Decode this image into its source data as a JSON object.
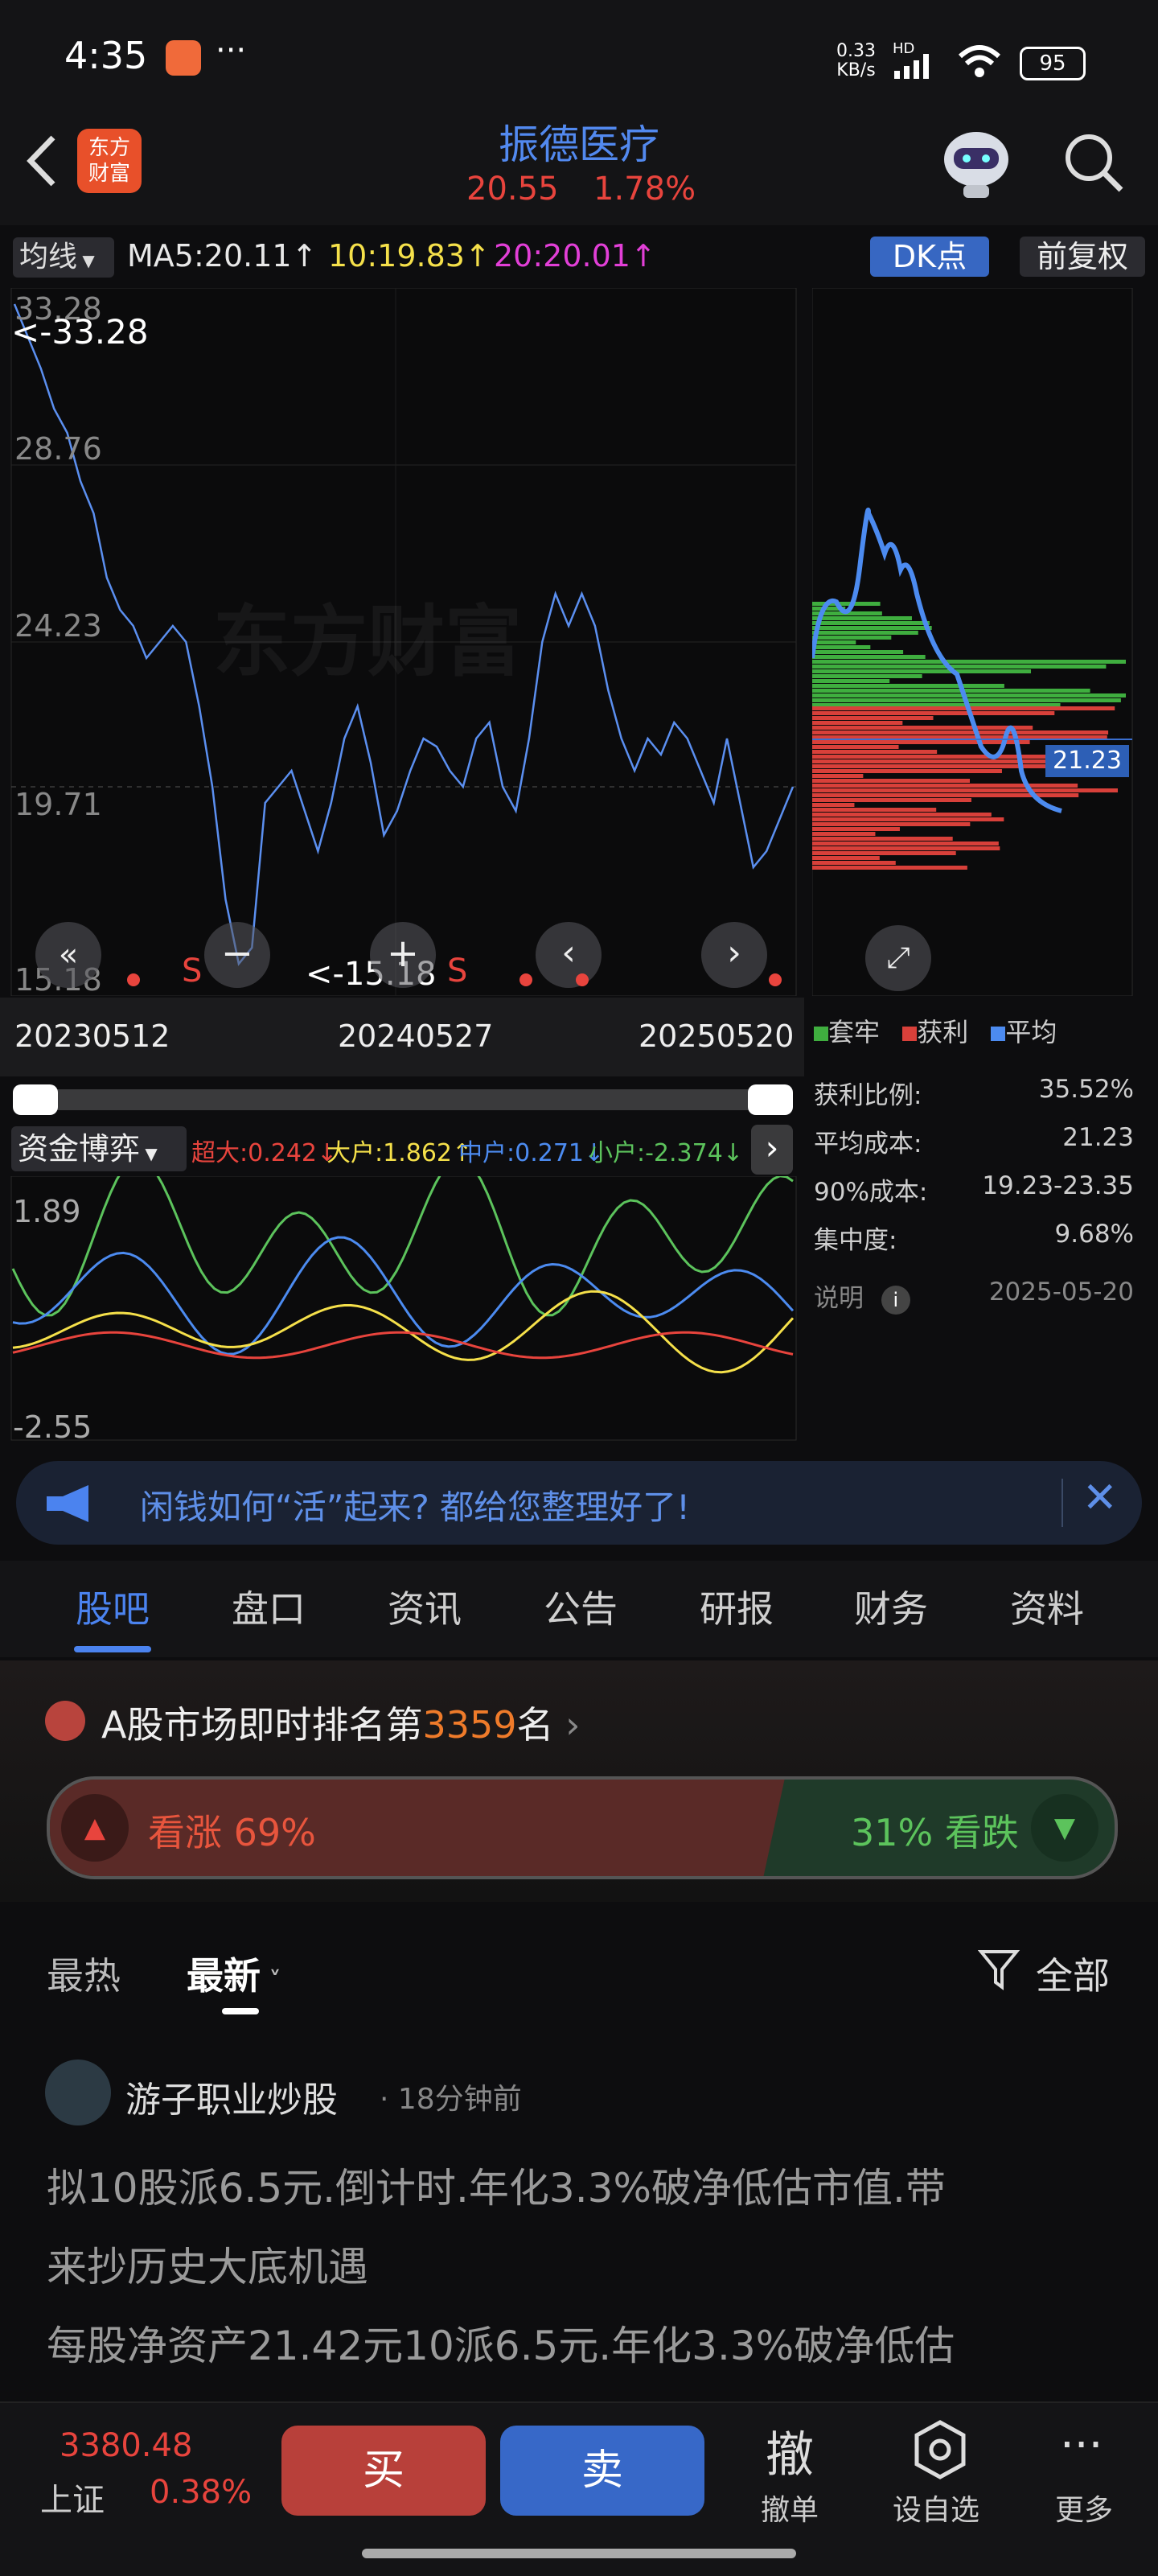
{
  "status_bar": {
    "time": "4:35",
    "more_dots": "···",
    "net_speed_top": "0.33",
    "net_speed_unit": "KB/s",
    "net_type": "HD",
    "battery": "95"
  },
  "header": {
    "logo_text_line1": "东方",
    "logo_text_line2": "财富",
    "stock_name": "振德医疗",
    "price": "20.55",
    "change_pct": "1.78%"
  },
  "ma_bar": {
    "selector_label": "均线",
    "ma5": "MA5:20.11",
    "ma10": "10:19.83",
    "ma20": "20:20.01",
    "arrow": "↑",
    "dk_label": "DK点",
    "adjust_label": "前复权"
  },
  "price_chart": {
    "y_labels": [
      "33.28",
      "28.76",
      "24.23",
      "19.71",
      "15.18"
    ],
    "max_marker": "<-33.28",
    "min_marker": "<-15.18",
    "s_label": "S",
    "watermark": "东方财富",
    "x_labels": [
      "20230512",
      "20240527",
      "20250520"
    ],
    "avg_price_tag": "21.23"
  },
  "chip_panel": {
    "legend": [
      {
        "label": "套牢",
        "color": "#3fae3f"
      },
      {
        "label": "获利",
        "color": "#d8403a"
      },
      {
        "label": "平均",
        "color": "#4c8bf0"
      }
    ],
    "rows": [
      {
        "label": "获利比例:",
        "value": "35.52%"
      },
      {
        "label": "平均成本:",
        "value": "21.23"
      },
      {
        "label": "90%成本:",
        "value": "19.23-23.35"
      },
      {
        "label": "集中度:",
        "value": "9.68%"
      }
    ],
    "note_label": "说明",
    "note_date": "2025-05-20"
  },
  "fund_game": {
    "title": "资金博弈",
    "super_large": "超大:0.242",
    "large": "大户:1.862",
    "medium": "中户:0.271",
    "small": "小户:-2.374",
    "y_top": "1.89",
    "y_bottom": "-2.55"
  },
  "notice": {
    "text": "闲钱如何“活”起来? 都给您整理好了!"
  },
  "tabs": [
    "股吧",
    "盘口",
    "资讯",
    "公告",
    "研报",
    "财务",
    "资料"
  ],
  "ranking": {
    "prefix": "A股市场即时排名第",
    "rank": "3359",
    "suffix": "名",
    "bull_label": "看涨 69%",
    "bear_label": "31% 看跌"
  },
  "feed_filter": {
    "hot": "最热",
    "latest": "最新",
    "all": "全部"
  },
  "post": {
    "author": "游子职业炒股",
    "time": "18分钟前",
    "line1": "拟10股派6.5元.倒计时.年化3.3%破净低估市值.带",
    "line2": "来抄历史大底机遇",
    "line3": "每股净资产21.42元10派6.5元.年化3.3%破净低估"
  },
  "bottom_bar": {
    "index_value": "3380.48",
    "index_name": "上证",
    "index_change": "0.38%",
    "buy": "买",
    "sell": "卖",
    "cancel_icon": "撤",
    "cancel": "撤单",
    "watchlist": "设自选",
    "more": "更多"
  }
}
